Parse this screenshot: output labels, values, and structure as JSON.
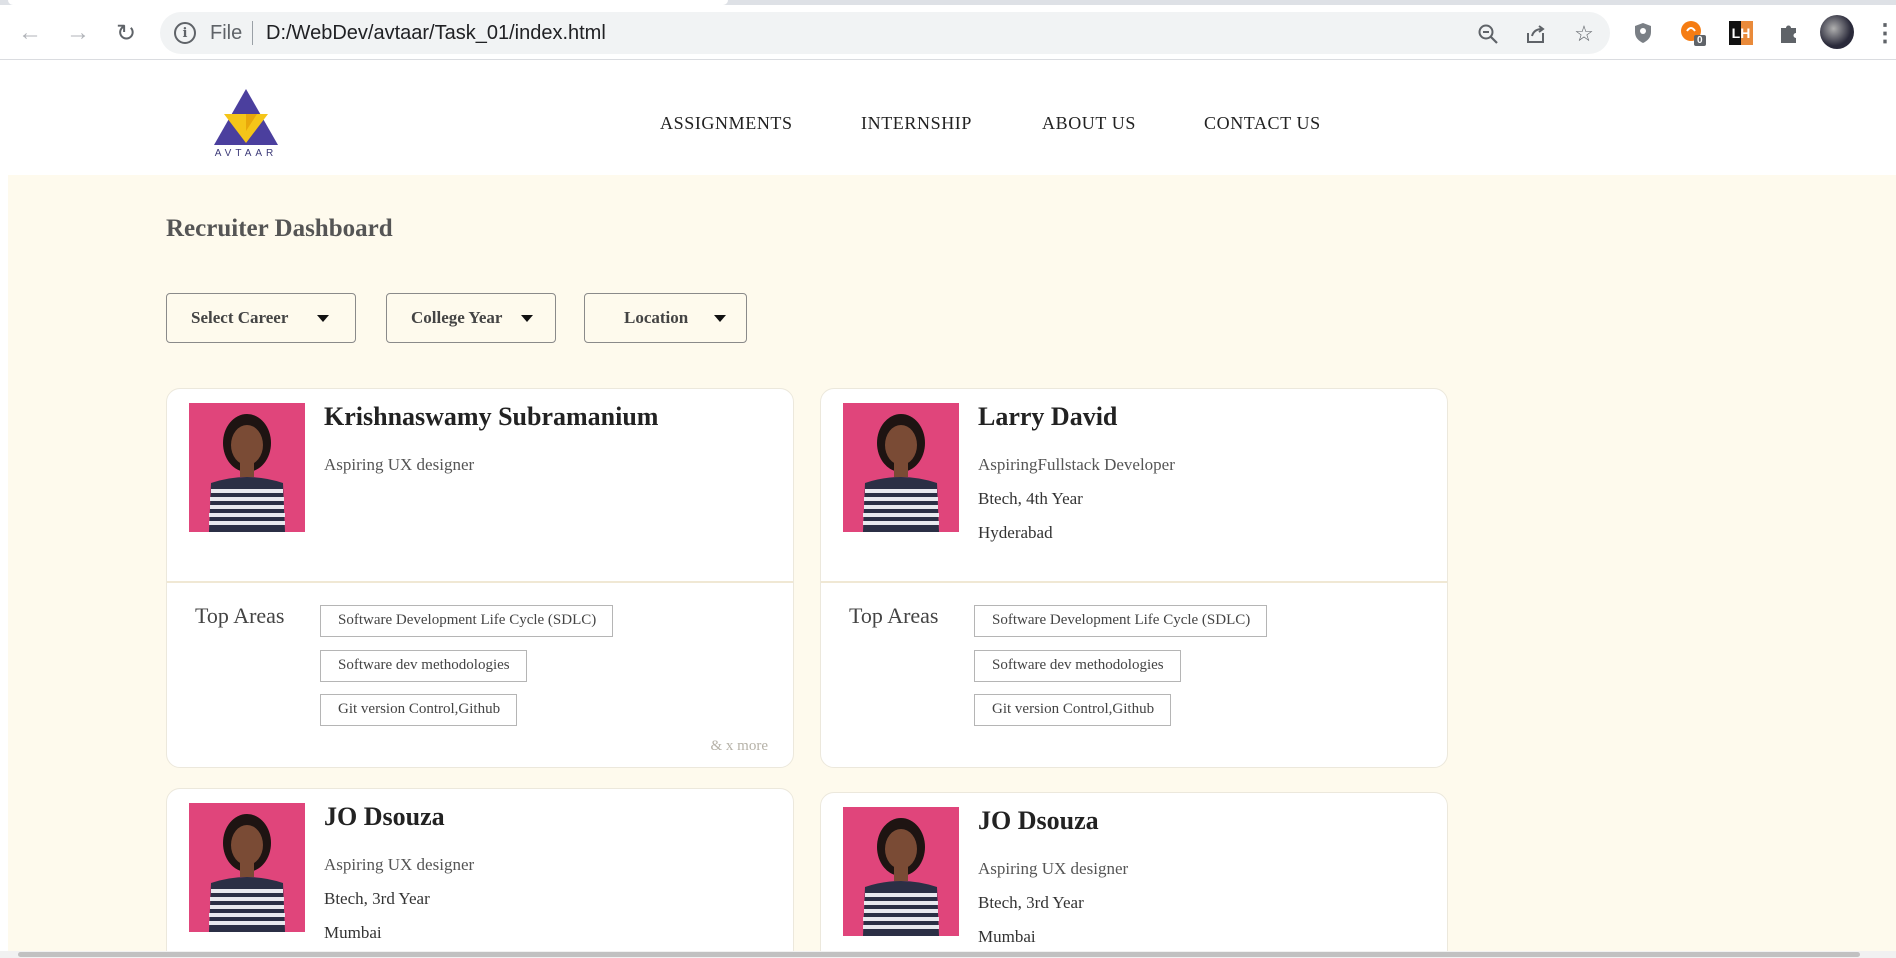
{
  "browser": {
    "url_scheme_label": "File",
    "url": "D:/WebDev/avtaar/Task_01/index.html",
    "icons": [
      "back-icon",
      "forward-icon",
      "reload-icon",
      "info-icon",
      "zoom-out-icon",
      "share-icon",
      "star-icon",
      "shield-extension-icon",
      "extension-badge-icon",
      "lighthouse-extension-icon",
      "puzzle-icon",
      "profile-avatar",
      "kebab-menu-icon"
    ],
    "extension_badge_count": "0",
    "lighthouse_label": "LH"
  },
  "site": {
    "logo_text": "AVTAAR",
    "nav": [
      "ASSIGNMENTS",
      "INTERNSHIP",
      "ABOUT US",
      "CONTACT US"
    ]
  },
  "dashboard": {
    "title": "Recruiter Dashboard",
    "filters": [
      "Select Career",
      "College Year",
      "Location"
    ]
  },
  "cards": [
    {
      "name": "Krishnaswamy Subramanium",
      "role": "Aspiring UX designer",
      "year": "",
      "location": "",
      "top_areas_label": "Top Areas",
      "tags": [
        "Software Development Life Cycle (SDLC)",
        "Software dev methodologies",
        "Git version Control,Github"
      ],
      "more": "& x more"
    },
    {
      "name": "Larry David",
      "role": "AspiringFullstack Developer",
      "year": "Btech, 4th Year",
      "location": "Hyderabad",
      "top_areas_label": "Top Areas",
      "tags": [
        "Software Development Life Cycle (SDLC)",
        "Software dev methodologies",
        "Git version Control,Github"
      ],
      "more": ""
    },
    {
      "name": "JO Dsouza",
      "role": "Aspiring UX designer",
      "year": "Btech, 3rd Year",
      "location": "Mumbai"
    },
    {
      "name": "JO Dsouza",
      "role": "Aspiring UX designer",
      "year": "Btech, 3rd Year",
      "location": "Mumbai"
    }
  ],
  "colors": {
    "page_background": "#fefaed",
    "logo_purple": "#4b3f9e",
    "logo_yellow": "#f5c518",
    "photo_background": "#e0457b"
  }
}
